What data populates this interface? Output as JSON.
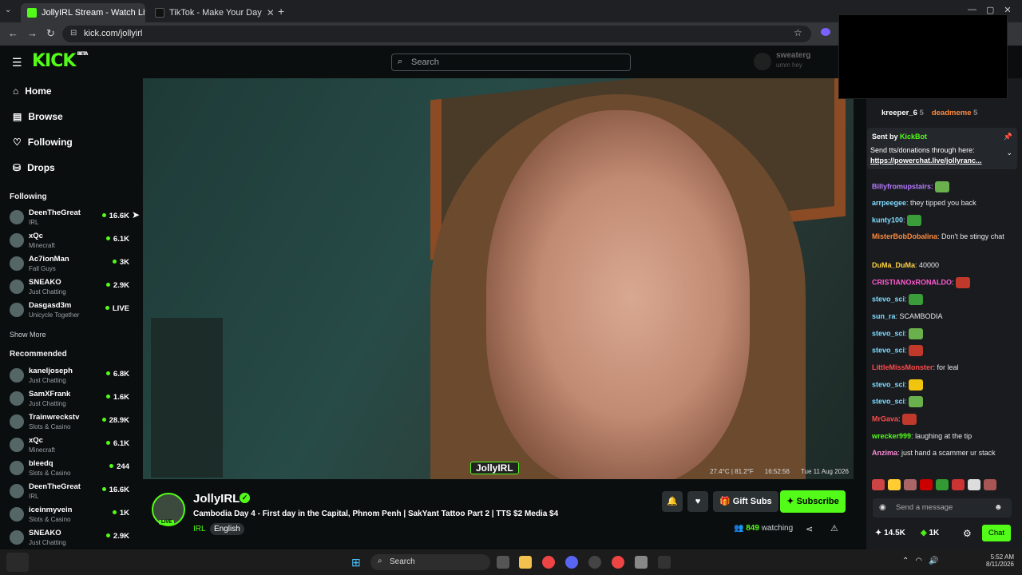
{
  "browser": {
    "tabs": [
      {
        "title": "JollyIRL Stream - Watch Live"
      },
      {
        "title": "TikTok - Make Your Day"
      }
    ],
    "url": "kick.com/jollyirl"
  },
  "header": {
    "logo": "KICK",
    "beta": "BETA",
    "search_placeholder": "Search",
    "user_name": "sweaterg",
    "user_sub": "umm hey"
  },
  "nav": {
    "items": [
      {
        "label": "Home"
      },
      {
        "label": "Browse"
      },
      {
        "label": "Following"
      },
      {
        "label": "Drops"
      }
    ]
  },
  "following": {
    "heading": "Following",
    "channels": [
      {
        "name": "DeenTheGreat",
        "category": "IRL",
        "viewers": "16.6K"
      },
      {
        "name": "xQc",
        "category": "Minecraft",
        "viewers": "6.1K"
      },
      {
        "name": "Ac7ionMan",
        "category": "Fall Guys",
        "viewers": "3K"
      },
      {
        "name": "SNEAKO",
        "category": "Just Chatting",
        "viewers": "2.9K"
      },
      {
        "name": "Dasgasd3m",
        "category": "Unicycle Together",
        "viewers": "LIVE"
      }
    ],
    "show_more": "Show More"
  },
  "recommended": {
    "heading": "Recommended",
    "channels": [
      {
        "name": "kaneljoseph",
        "category": "Just Chatting",
        "viewers": "6.8K"
      },
      {
        "name": "SamXFrank",
        "category": "Just Chatting",
        "viewers": "1.6K"
      },
      {
        "name": "Trainwreckstv",
        "category": "Slots & Casino",
        "viewers": "28.9K"
      },
      {
        "name": "xQc",
        "category": "Minecraft",
        "viewers": "6.1K"
      },
      {
        "name": "bleedq",
        "category": "Slots & Casino",
        "viewers": "244"
      },
      {
        "name": "DeenTheGreat",
        "category": "IRL",
        "viewers": "16.6K"
      },
      {
        "name": "iceinmyvein",
        "category": "Slots & Casino",
        "viewers": "1K"
      },
      {
        "name": "SNEAKO",
        "category": "Just Chatting",
        "viewers": "2.9K"
      }
    ]
  },
  "video": {
    "watermark": "JollyIRL",
    "stamp_temp": "27.4°C | 81.2°F",
    "stamp_time": "16:52:56",
    "stamp_date": "Tue 11 Aug 2026"
  },
  "stream": {
    "streamer": "JollyIRL",
    "title": "Cambodia Day 4 - First day in the Capital, Phnom Penh | SakYant Tattoo Part 2 | TTS $2 Media $4",
    "category": "IRL",
    "language": "English",
    "live_badge": "LIVE",
    "viewers": "849",
    "viewers_label": "watching",
    "gift_label": "Gift Subs",
    "subscribe_label": "Subscribe"
  },
  "chat": {
    "top_users": [
      {
        "name": "kreeper_6",
        "count": "5"
      },
      {
        "name": "deadmeme",
        "count": "5"
      }
    ],
    "pinned": {
      "sent_by": "Sent by",
      "bot": "KickBot",
      "text": "Send tts/donations through here:",
      "link": "https://powerchat.live/jollyranc..."
    },
    "messages": [
      {
        "user": "Billyfromupstairs",
        "color": "#b77cff",
        "text": ""
      },
      {
        "user": "arrpeegee",
        "color": "#7fdcff",
        "text": "they tipped you back"
      },
      {
        "user": "kunty100",
        "color": "#7fdcff",
        "text": ""
      },
      {
        "user": "MisterBobDobalina",
        "color": "#ff8a3d",
        "text": "Don't be stingy chat"
      },
      {
        "user": "DuMa_DuMa",
        "color": "#ffd23f",
        "text": "40000"
      },
      {
        "user": "CRISTIANOxRONALDO",
        "color": "#ff5ad0",
        "text": ""
      },
      {
        "user": "stevo_sci",
        "color": "#7fdcff",
        "text": ""
      },
      {
        "user": "sun_ra",
        "color": "#7fdcff",
        "text": "SCAMBODIA"
      },
      {
        "user": "stevo_sci",
        "color": "#7fdcff",
        "text": ""
      },
      {
        "user": "stevo_sci",
        "color": "#7fdcff",
        "text": ""
      },
      {
        "user": "LittleMissMonster",
        "color": "#ff4b4b",
        "text": "for leal"
      },
      {
        "user": "stevo_sci",
        "color": "#7fdcff",
        "text": ""
      },
      {
        "user": "stevo_sci",
        "color": "#7fdcff",
        "text": ""
      },
      {
        "user": "MrGava",
        "color": "#ff4b4b",
        "text": ""
      },
      {
        "user": "wrecker999",
        "color": "#53fc18",
        "text": "laughing at the tip"
      },
      {
        "user": "Anzima",
        "color": "#ff8ad8",
        "text": "just hand a scammer ur stack"
      }
    ],
    "input_placeholder": "Send a message",
    "stat1": "14.5K",
    "stat2": "1K",
    "chat_button": "Chat"
  },
  "taskbar": {
    "search": "Search",
    "time": "5:52 AM",
    "date": "8/11/2026"
  },
  "colors": {
    "accent": "#53fc18"
  }
}
